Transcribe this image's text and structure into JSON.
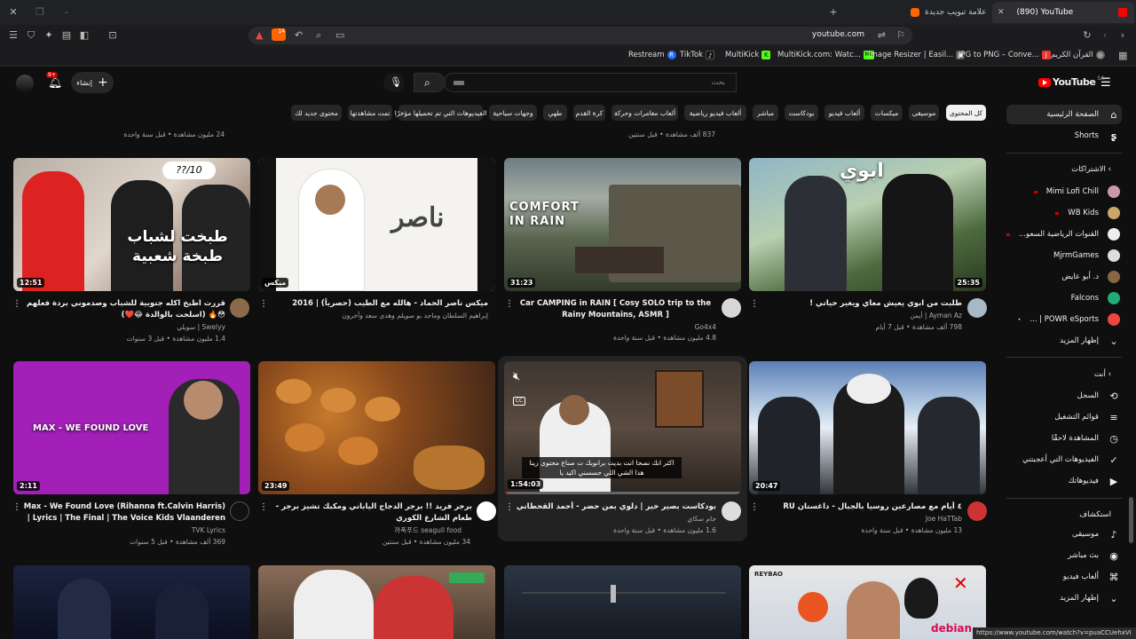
{
  "browser": {
    "tabs": [
      {
        "title": "(890) YouTube",
        "active": true
      },
      {
        "title": "علامة تبويب جديدة",
        "active": false
      }
    ],
    "url": "youtube.com",
    "shield_count": "14",
    "status_url": "https://www.youtube.com/watch?v=puaCCUehxVI",
    "bookmarks": [
      {
        "label": "Restream",
        "color": "#1e6bff",
        "glyph": "R"
      },
      {
        "label": "TikTok",
        "color": "#111111",
        "glyph": "♪"
      },
      {
        "label": "MultiKick",
        "color": "#53fc18",
        "glyph": "K"
      },
      {
        "label": "MultiKick.com: Watc...",
        "color": "#53fc18",
        "glyph": "MK"
      },
      {
        "label": "Image Resizer | Easil...",
        "color": "#333333",
        "glyph": "▣"
      },
      {
        "label": "JPG to PNG – Conve...",
        "color": "#e33",
        "glyph": "J"
      },
      {
        "label": "القرآن الكريم",
        "color": "#666",
        "glyph": "◎"
      }
    ]
  },
  "header": {
    "logo": "YouTube",
    "region": "SA",
    "search_placeholder": "بحث",
    "create_label": "إنشاء",
    "notif_count": "9+"
  },
  "chips": [
    "كل المحتوى",
    "موسيقى",
    "ميكسات",
    "ألعاب فيديو",
    "بودكاست",
    "مباشر",
    "ألعاب فيديو رياضية",
    "ألعاب مغامرات وحركة",
    "كرة القدم",
    "طهي",
    "وجهات سياحية",
    "الفيديوهات التي تم تحميلها مؤخرًا",
    "تمت مشاهدتها",
    "محتوى جديد لك"
  ],
  "sidebar": {
    "main": [
      {
        "label": "الصفحة الرئيسية",
        "icon": "home-icon",
        "glyph": "⌂"
      },
      {
        "label": "Shorts",
        "icon": "shorts-icon",
        "glyph": "S"
      }
    ],
    "subs_header": "الاشتراكات",
    "subs": [
      {
        "label": "Mimi Lofi Chill",
        "color": "#c9a"
      },
      {
        "label": "WB Kids",
        "color": "#cba66a"
      },
      {
        "label": "القنوات الرياضية السعو...",
        "color": "#eee"
      },
      {
        "label": "MjrmGames",
        "color": "#ddd"
      },
      {
        "label": "د. أبو عايض",
        "color": "#886644"
      },
      {
        "label": "Falcons",
        "color": "#2a7"
      },
      {
        "label": "POWR eSports | ...",
        "color": "#e44"
      }
    ],
    "show_more_subs": "إظهار المزيد",
    "you_header": "أنت",
    "you": [
      {
        "label": "السجل",
        "glyph": "⟲"
      },
      {
        "label": "قوائم التشغيل",
        "glyph": "≡"
      },
      {
        "label": "المشاهدة لاحقًا",
        "glyph": "◷"
      },
      {
        "label": "الفيديوهات التي أعجبتني",
        "glyph": "👍"
      },
      {
        "label": "فيديوهاتك",
        "glyph": "▶"
      }
    ],
    "explore_header": "استكشاف",
    "explore": [
      {
        "label": "موسيقى",
        "glyph": "♪"
      },
      {
        "label": "بث مباشر",
        "glyph": "◉"
      },
      {
        "label": "ألعاب فيديو",
        "glyph": "⌘"
      },
      {
        "label": "إظهار المزيد",
        "glyph": "⌄"
      }
    ]
  },
  "top_partial": [
    {
      "meta": "837 ألف مشاهدة • قبل سنتين"
    },
    {
      "meta": "24 مليون مشاهدة • قبل سنة واحدة"
    }
  ],
  "videos_row1": [
    {
      "title": "طلبت من ابوي يعيش معاي ويغير حياتي !",
      "channel": "Ayman Az | أيمن",
      "meta": "798 ألف مشاهدة • قبل 7 أيام",
      "duration": "25:35",
      "overlay": "ابوي"
    },
    {
      "title": "Car CAMPING in RAIN [ Cosy SOLO trip to the Rainy Mountains, ASMR ]",
      "channel": "Go4x4",
      "meta": "4.8 مليون مشاهدة • قبل سنة واحدة",
      "duration": "31:23",
      "overlay": "COMFORT IN RAIN"
    },
    {
      "title": "ميكس ناصر الحماد - هالله مع الطيب (حصرياً) | 2016",
      "channel": "إبراهيم السلطان وماجد بو سويلم وهدى سعد وآخرون",
      "meta": "",
      "duration": "ميكس",
      "overlay": "ناصر"
    },
    {
      "title": "قررت اطبخ اكله جنوبية للشباب وصدموني بردة فعلهم 😳🔥 (اسلحت بالوالدة 😂❤️)",
      "channel": "Swelyy | سويلي",
      "meta": "1.4 مليون مشاهدة • قبل 3 سنوات",
      "duration": "12:51",
      "overlay": "طبخت لشباب طبخة شعبية"
    }
  ],
  "videos_row2": [
    {
      "title": "٤ أيام مع مصارعين روسيا بالجبال - داغستان RU",
      "channel": "Joe HaTTab",
      "meta": "13 مليون مشاهدة • قبل سنة واحدة",
      "duration": "20:47"
    },
    {
      "title": "بودكاست بصير خير | دلوي بمن حضر - أحمد القحطاني (شوتي)",
      "channel": "جام سكاي",
      "meta": "1.6 مليون مشاهدة • قبل سنة واحدة",
      "duration": "1:54:03",
      "subtitle": "اكثر انك نصحا انت بديت برانوبك ت صناع محتوى زينا هذا الشي اللي حسسني اكيد يا"
    },
    {
      "title": "برجر فريد !! برجر الدجاج الياباني ومكبك تشيز برجر - طعام الشارع الكوري",
      "channel": "까폭푸드 seagull food",
      "meta": "34 مليون مشاهدة • قبل سنتين",
      "duration": "23:49"
    },
    {
      "title": "Max - We Found Love (Rihanna ft.Calvin Harris) | Lyrics | The Final | The Voice Kids Vlaanderen 2020",
      "channel": "TVK Lyrics",
      "meta": "369 ألف مشاهدة • قبل 5 سنوات",
      "duration": "2:11",
      "overlay": "MAX - WE FOUND LOVE"
    }
  ],
  "row3_labels": {
    "debian": "debian",
    "reybao": "REYBAO"
  },
  "colors": {
    "accent": "#ff0000",
    "bg": "#0f0f0f",
    "chip": "#272727"
  }
}
